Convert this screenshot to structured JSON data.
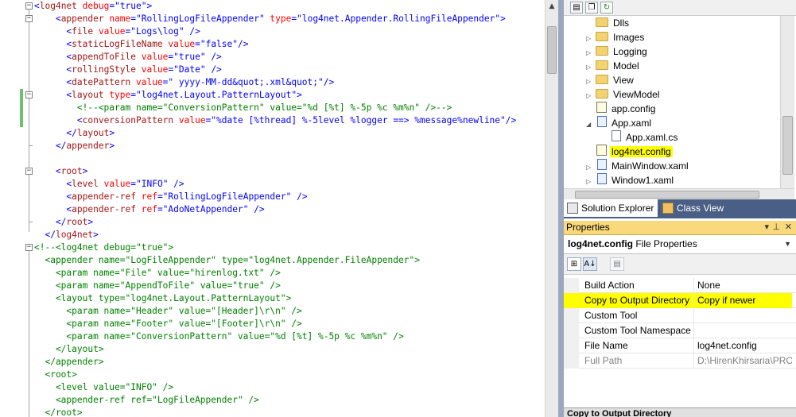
{
  "editor": {
    "lines": [
      [
        {
          "t": "<",
          "c": "punc"
        },
        {
          "t": "log4net",
          "c": "tag"
        },
        {
          "t": " debug",
          "c": "attr"
        },
        {
          "t": "=\"",
          "c": "punc"
        },
        {
          "t": "true",
          "c": "val"
        },
        {
          "t": "\">",
          "c": "punc"
        }
      ],
      [
        {
          "t": "    <",
          "c": "punc"
        },
        {
          "t": "appender",
          "c": "tag"
        },
        {
          "t": " name",
          "c": "attr"
        },
        {
          "t": "=\"",
          "c": "punc"
        },
        {
          "t": "RollingLogFileAppender",
          "c": "val"
        },
        {
          "t": "\"",
          "c": "punc"
        },
        {
          "t": " type",
          "c": "attr"
        },
        {
          "t": "=\"",
          "c": "punc"
        },
        {
          "t": "log4net.Appender.RollingFileAppender",
          "c": "val"
        },
        {
          "t": "\">",
          "c": "punc"
        }
      ],
      [
        {
          "t": "      <",
          "c": "punc"
        },
        {
          "t": "file",
          "c": "tag"
        },
        {
          "t": " value",
          "c": "attr"
        },
        {
          "t": "=\"",
          "c": "punc"
        },
        {
          "t": "Logs\\log",
          "c": "val"
        },
        {
          "t": "\" />",
          "c": "punc"
        }
      ],
      [
        {
          "t": "      <",
          "c": "punc"
        },
        {
          "t": "staticLogFileName",
          "c": "tag"
        },
        {
          "t": " value",
          "c": "attr"
        },
        {
          "t": "=\"",
          "c": "punc"
        },
        {
          "t": "false",
          "c": "val"
        },
        {
          "t": "\"/>",
          "c": "punc"
        }
      ],
      [
        {
          "t": "      <",
          "c": "punc"
        },
        {
          "t": "appendToFile",
          "c": "tag"
        },
        {
          "t": " value",
          "c": "attr"
        },
        {
          "t": "=\"",
          "c": "punc"
        },
        {
          "t": "true",
          "c": "val"
        },
        {
          "t": "\" />",
          "c": "punc"
        }
      ],
      [
        {
          "t": "      <",
          "c": "punc"
        },
        {
          "t": "rollingStyle",
          "c": "tag"
        },
        {
          "t": " value",
          "c": "attr"
        },
        {
          "t": "=\"",
          "c": "punc"
        },
        {
          "t": "Date",
          "c": "val"
        },
        {
          "t": "\" />",
          "c": "punc"
        }
      ],
      [
        {
          "t": "      <",
          "c": "punc"
        },
        {
          "t": "datePattern",
          "c": "tag"
        },
        {
          "t": " value",
          "c": "attr"
        },
        {
          "t": "=\"",
          "c": "punc"
        },
        {
          "t": " yyyy-MM-dd&quot;.xml&quot;",
          "c": "val"
        },
        {
          "t": "\"/>",
          "c": "punc"
        }
      ],
      [
        {
          "t": "      <",
          "c": "punc"
        },
        {
          "t": "layout",
          "c": "tag"
        },
        {
          "t": " type",
          "c": "attr"
        },
        {
          "t": "=\"",
          "c": "punc"
        },
        {
          "t": "log4net.Layout.PatternLayout",
          "c": "val"
        },
        {
          "t": "\">",
          "c": "punc"
        }
      ],
      [
        {
          "t": "        <!--<param name=\"ConversionPattern\" value=\"%d [%t] %-5p %c %m%n\" />-->",
          "c": "cmt"
        }
      ],
      [
        {
          "t": "        <",
          "c": "punc"
        },
        {
          "t": "conversionPattern",
          "c": "tag"
        },
        {
          "t": " value",
          "c": "attr"
        },
        {
          "t": "=\"",
          "c": "punc"
        },
        {
          "t": "%date [%thread] %-5level %logger ==> %message%newline",
          "c": "val"
        },
        {
          "t": "\"/>",
          "c": "punc"
        }
      ],
      [
        {
          "t": "      </",
          "c": "punc"
        },
        {
          "t": "layout",
          "c": "tag"
        },
        {
          "t": ">",
          "c": "punc"
        }
      ],
      [
        {
          "t": "    </",
          "c": "punc"
        },
        {
          "t": "appender",
          "c": "tag"
        },
        {
          "t": ">",
          "c": "punc"
        }
      ],
      [
        {
          "t": "",
          "c": "txt"
        }
      ],
      [
        {
          "t": "    <",
          "c": "punc"
        },
        {
          "t": "root",
          "c": "tag"
        },
        {
          "t": ">",
          "c": "punc"
        }
      ],
      [
        {
          "t": "      <",
          "c": "punc"
        },
        {
          "t": "level",
          "c": "tag"
        },
        {
          "t": " value",
          "c": "attr"
        },
        {
          "t": "=\"",
          "c": "punc"
        },
        {
          "t": "INFO",
          "c": "val"
        },
        {
          "t": "\" />",
          "c": "punc"
        }
      ],
      [
        {
          "t": "      <",
          "c": "punc"
        },
        {
          "t": "appender-ref",
          "c": "tag"
        },
        {
          "t": " ref",
          "c": "attr"
        },
        {
          "t": "=\"",
          "c": "punc"
        },
        {
          "t": "RollingLogFileAppender",
          "c": "val"
        },
        {
          "t": "\" />",
          "c": "punc"
        }
      ],
      [
        {
          "t": "      <",
          "c": "punc"
        },
        {
          "t": "appender-ref",
          "c": "tag"
        },
        {
          "t": " ref",
          "c": "attr"
        },
        {
          "t": "=\"",
          "c": "punc"
        },
        {
          "t": "AdoNetAppender",
          "c": "val"
        },
        {
          "t": "\" />",
          "c": "punc"
        }
      ],
      [
        {
          "t": "    </",
          "c": "punc"
        },
        {
          "t": "root",
          "c": "tag"
        },
        {
          "t": ">",
          "c": "punc"
        }
      ],
      [
        {
          "t": "  </",
          "c": "punc"
        },
        {
          "t": "log4net",
          "c": "tag"
        },
        {
          "t": ">",
          "c": "punc"
        }
      ],
      [
        {
          "t": "<!--<log4net debug=\"true\">",
          "c": "cmt"
        }
      ],
      [
        {
          "t": "  <appender name=\"LogFileAppender\" type=\"log4net.Appender.FileAppender\">",
          "c": "cmt"
        }
      ],
      [
        {
          "t": "    <param name=\"File\" value=\"hirenlog.txt\" />",
          "c": "cmt"
        }
      ],
      [
        {
          "t": "    <param name=\"AppendToFile\" value=\"true\" />",
          "c": "cmt"
        }
      ],
      [
        {
          "t": "    <layout type=\"log4net.Layout.PatternLayout\">",
          "c": "cmt"
        }
      ],
      [
        {
          "t": "      <param name=\"Header\" value=\"[Header]\\r\\n\" />",
          "c": "cmt"
        }
      ],
      [
        {
          "t": "      <param name=\"Footer\" value=\"[Footer]\\r\\n\" />",
          "c": "cmt"
        }
      ],
      [
        {
          "t": "      <param name=\"ConversionPattern\" value=\"%d [%t] %-5p %c %m%n\" />",
          "c": "cmt"
        }
      ],
      [
        {
          "t": "    </layout>",
          "c": "cmt"
        }
      ],
      [
        {
          "t": "  </appender>",
          "c": "cmt"
        }
      ],
      [
        {
          "t": "  <root>",
          "c": "cmt"
        }
      ],
      [
        {
          "t": "    <level value=\"INFO\" />",
          "c": "cmt"
        }
      ],
      [
        {
          "t": "    <appender-ref ref=\"LogFileAppender\" />",
          "c": "cmt"
        }
      ],
      [
        {
          "t": "  </root>",
          "c": "cmt"
        }
      ]
    ]
  },
  "solution_explorer": {
    "items": [
      {
        "label": "Dlls",
        "icon": "folder-icon",
        "kind": "folder",
        "expander": "",
        "indent": 0,
        "highlight": false
      },
      {
        "label": "Images",
        "icon": "folder-icon",
        "kind": "folder",
        "expander": "▷",
        "indent": 0,
        "highlight": false
      },
      {
        "label": "Logging",
        "icon": "folder-icon",
        "kind": "folder",
        "expander": "▷",
        "indent": 0,
        "highlight": false
      },
      {
        "label": "Model",
        "icon": "folder-icon",
        "kind": "folder",
        "expander": "▷",
        "indent": 0,
        "highlight": false
      },
      {
        "label": "View",
        "icon": "folder-icon",
        "kind": "folder",
        "expander": "▷",
        "indent": 0,
        "highlight": false
      },
      {
        "label": "ViewModel",
        "icon": "folder-icon",
        "kind": "folder",
        "expander": "▷",
        "indent": 0,
        "highlight": false
      },
      {
        "label": "app.config",
        "icon": "config-file-icon",
        "kind": "cfg",
        "expander": "",
        "indent": 0,
        "highlight": false
      },
      {
        "label": "App.xaml",
        "icon": "xaml-file-icon",
        "kind": "xaml",
        "expander": "◢",
        "indent": 0,
        "highlight": false
      },
      {
        "label": "App.xaml.cs",
        "icon": "cs-file-icon",
        "kind": "file",
        "expander": "",
        "indent": 1,
        "highlight": false
      },
      {
        "label": "log4net.config",
        "icon": "config-file-icon",
        "kind": "cfg",
        "expander": "",
        "indent": 0,
        "highlight": true
      },
      {
        "label": "MainWindow.xaml",
        "icon": "xaml-file-icon",
        "kind": "xaml",
        "expander": "▷",
        "indent": 0,
        "highlight": false
      },
      {
        "label": "Window1.xaml",
        "icon": "xaml-file-icon",
        "kind": "xaml",
        "expander": "▷",
        "indent": 0,
        "highlight": false
      }
    ],
    "tabs": {
      "solution": "Solution Explorer",
      "class_view": "Class View"
    }
  },
  "properties": {
    "title": "Properties",
    "pin_glyph": "▾ ⊥ ✕",
    "object_name": "log4net.config",
    "object_type": "File Properties",
    "rows": [
      {
        "name": "Build Action",
        "value": "None",
        "highlight": false,
        "dim": false
      },
      {
        "name": "Copy to Output Directory",
        "value": "Copy if newer",
        "highlight": true,
        "dim": false
      },
      {
        "name": "Custom Tool",
        "value": "",
        "highlight": false,
        "dim": false
      },
      {
        "name": "Custom Tool Namespace",
        "value": "",
        "highlight": false,
        "dim": false
      },
      {
        "name": "File Name",
        "value": "log4net.config",
        "highlight": false,
        "dim": false
      },
      {
        "name": "Full Path",
        "value": "D:\\HirenKhirsaria\\PRO",
        "highlight": false,
        "dim": true
      }
    ],
    "description_title": "Copy to Output Directory"
  },
  "colors": {
    "highlight": "#ffff00",
    "title_bar": "#f9d97b",
    "tab_strip": "#4a5f85",
    "change_bar": "#6cc26c"
  }
}
